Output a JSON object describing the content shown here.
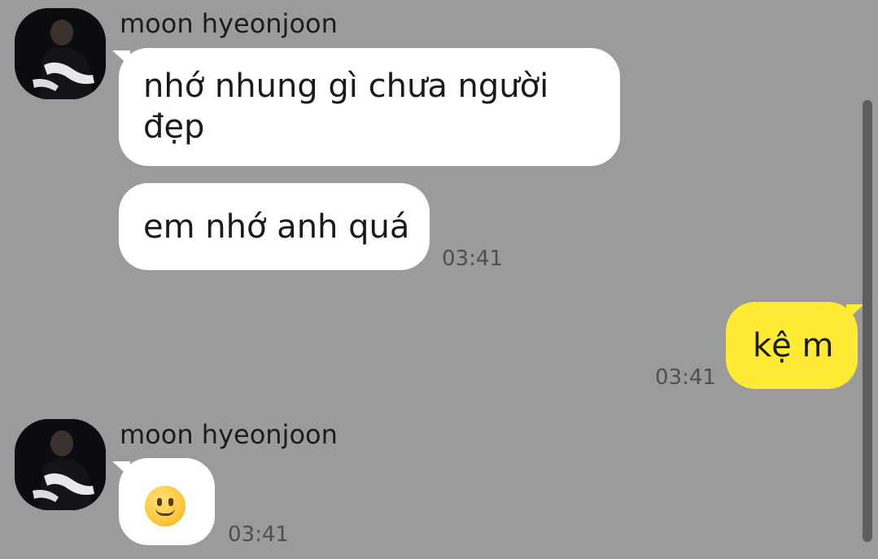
{
  "conversation": {
    "groups": [
      {
        "sender": "moon hyeonjoon",
        "avatar_icon": "profile-photo-avatar",
        "messages": [
          {
            "lines": [
              "nhớ nhung gì chưa người",
              "đẹp"
            ]
          },
          {
            "lines": [
              "em nhớ anh quá"
            ],
            "time": "03:41"
          }
        ]
      },
      {
        "sender": "me",
        "messages": [
          {
            "lines": [
              "kệ m"
            ],
            "time": "03:41"
          }
        ]
      },
      {
        "sender": "moon hyeonjoon",
        "avatar_icon": "profile-photo-avatar",
        "messages": [
          {
            "emoji": "slightly-smiling-face-icon",
            "time": "03:41"
          }
        ]
      }
    ]
  },
  "colors": {
    "background": "#9b9b9b",
    "incoming_bubble": "#ffffff",
    "outgoing_bubble": "#ffeb33",
    "time_text": "#4f4f4f",
    "scrollbar": "#5e5e5e"
  }
}
